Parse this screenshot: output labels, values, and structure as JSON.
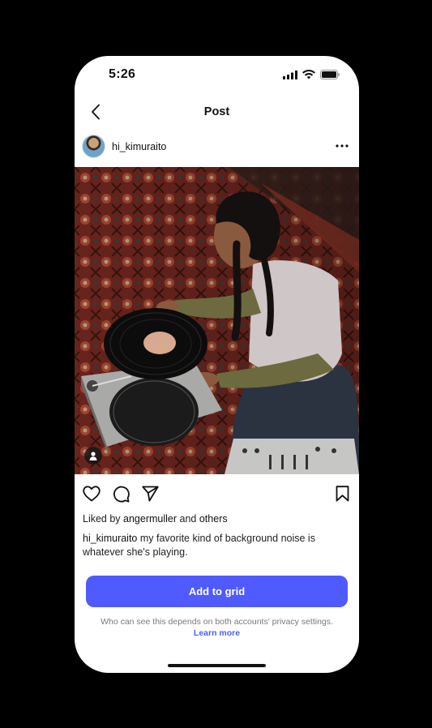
{
  "status_bar": {
    "time": "5:26"
  },
  "header": {
    "title": "Post",
    "back_icon": "chevron-left-icon"
  },
  "post": {
    "author": "hi_kimuraito",
    "more_icon": "ellipsis-icon",
    "photo_description_icon": "photo",
    "likes": {
      "prefix": "Liked by ",
      "user": "angermuller",
      "middle": " and ",
      "others": "others"
    },
    "caption": {
      "user": "hi_kimuraito",
      "text": " my favorite kind of background noise is whatever she's playing."
    }
  },
  "actions": {
    "like_icon": "heart-icon",
    "comment_icon": "comment-icon",
    "share_icon": "send-icon",
    "save_icon": "bookmark-icon"
  },
  "cta": {
    "button_label": "Add to grid",
    "privacy_note": "Who can see this depends on both accounts' privacy settings.",
    "learn_more": "Learn more"
  },
  "colors": {
    "accent": "#4f5bff",
    "background": "#000000",
    "surface": "#ffffff"
  }
}
